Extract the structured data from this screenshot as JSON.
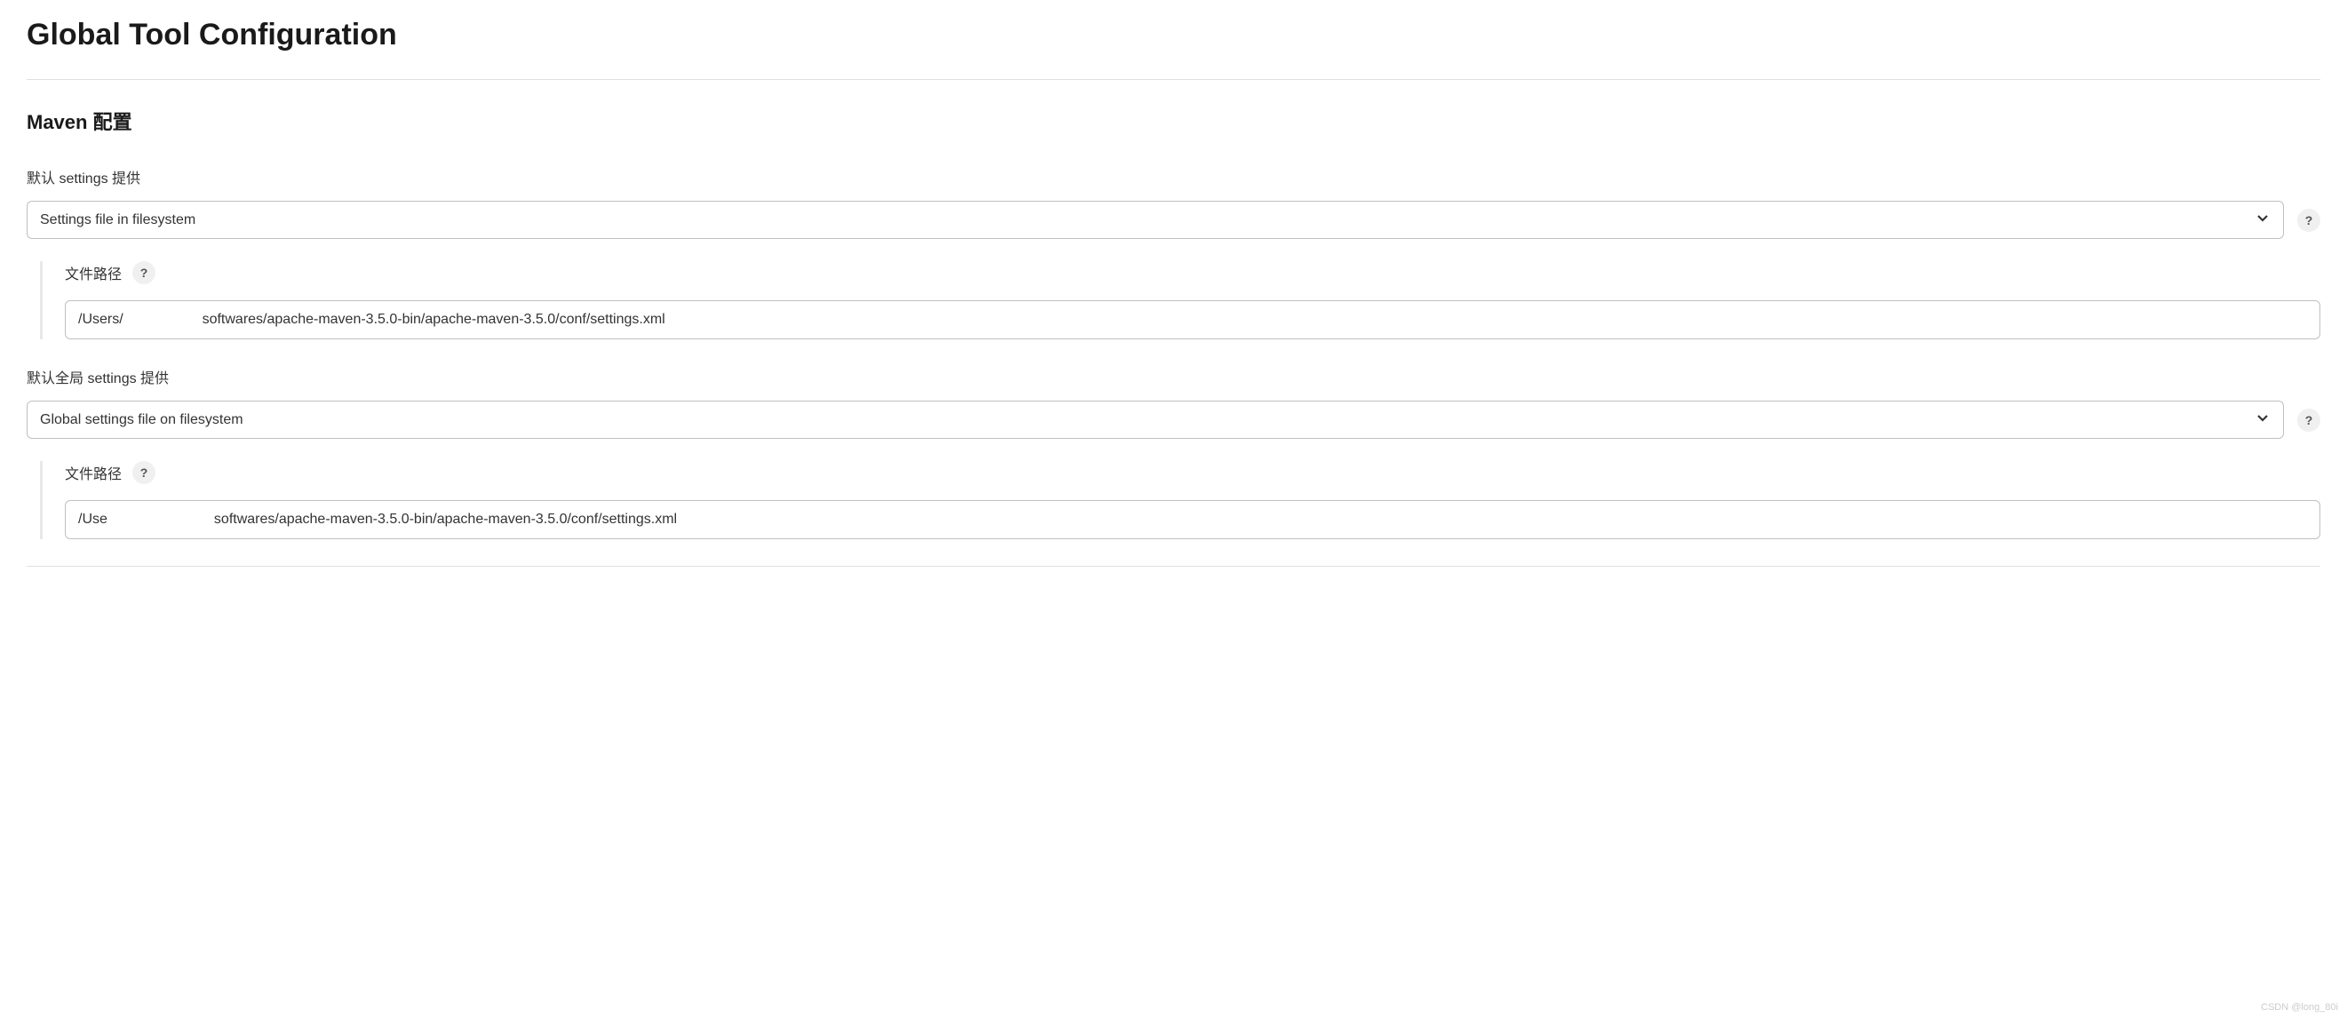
{
  "page": {
    "title": "Global Tool Configuration"
  },
  "maven": {
    "section_title": "Maven 配置",
    "default_settings": {
      "label": "默认 settings 提供",
      "selected": "Settings file in filesystem",
      "file_path_label": "文件路径",
      "file_path_value": "/Users/​                    softwares/apache-maven-3.5.0-bin/apache-maven-3.5.0/conf/settings.xml"
    },
    "default_global_settings": {
      "label": "默认全局 settings 提供",
      "selected": "Global settings file on filesystem",
      "file_path_label": "文件路径",
      "file_path_value": "/Use                           softwares/apache-maven-3.5.0-bin/apache-maven-3.5.0/conf/settings.xml"
    }
  },
  "help_symbol": "?",
  "watermark": "CSDN @long_80i"
}
